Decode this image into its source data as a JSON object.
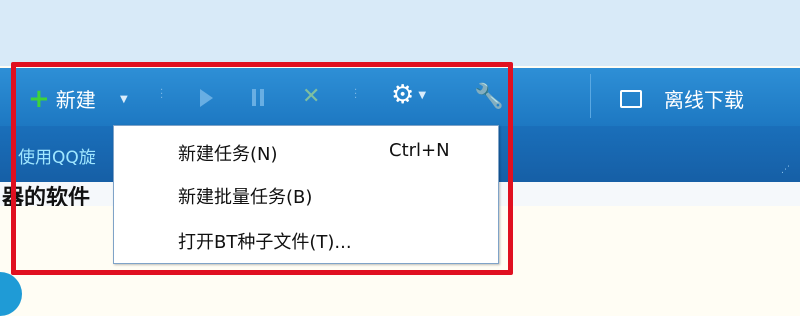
{
  "toolbar": {
    "new_label": "新建",
    "offline_label": "离线下载",
    "icons": {
      "plus": "plus-icon",
      "caret": "caret-down-icon",
      "play": "play-icon",
      "pause": "pause-icon",
      "delete": "delete-x-icon",
      "settings": "gear-icon",
      "tools": "wrench-icon",
      "offline": "offline-download-icon"
    }
  },
  "subbar": {
    "text": "使用QQ旋"
  },
  "content": {
    "strip_text": "器的软件"
  },
  "menu": {
    "items": [
      {
        "label": "新建任务(N)",
        "shortcut": "Ctrl+N"
      },
      {
        "label": "新建批量任务(B)",
        "shortcut": ""
      },
      {
        "label": "打开BT种子文件(T)...",
        "shortcut": ""
      }
    ]
  },
  "colors": {
    "toolbar": "#1d78c2",
    "subbar": "#165fa6",
    "highlight": "#e01020",
    "plus": "#3ed33a"
  }
}
